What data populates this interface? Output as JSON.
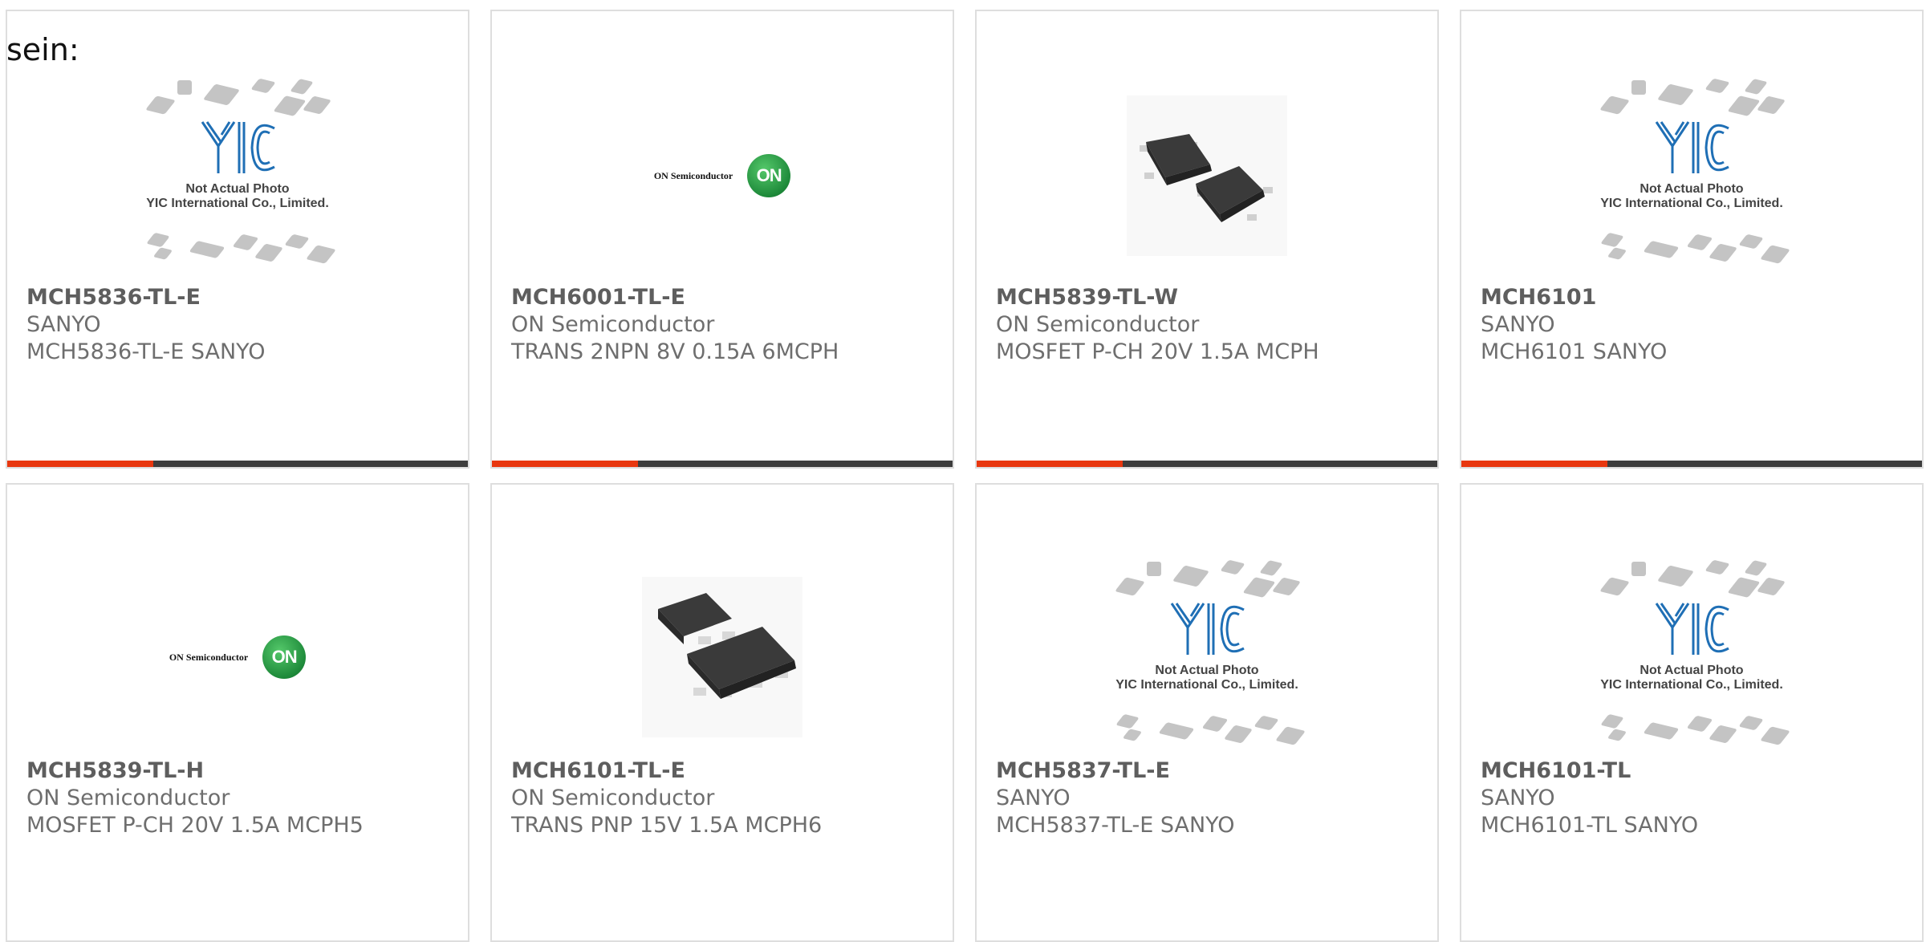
{
  "intro_text": "sein:",
  "placeholder": {
    "line1": "Not Actual Photo",
    "line2": "YIC International Co., Limited.",
    "logo_text": "YIC"
  },
  "on_logo": {
    "text": "ON Semiconductor",
    "mark": "ON"
  },
  "colors": {
    "accent": "#e8370f",
    "bar": "#3d3d3d",
    "border": "#dedede",
    "on_green": "#1e8a3a",
    "yic_blue": "#1f6fb5"
  },
  "products": [
    {
      "part": "MCH5836-TL-E",
      "manufacturer": "SANYO",
      "description": "MCH5836-TL-E SANYO",
      "image": "yic-placeholder"
    },
    {
      "part": "MCH6001-TL-E",
      "manufacturer": "ON Semiconductor",
      "description": "TRANS 2NPN 8V 0.15A 6MCPH",
      "image": "on-semiconductor-logo"
    },
    {
      "part": "MCH5839-TL-W",
      "manufacturer": "ON Semiconductor",
      "description": "MOSFET P-CH 20V 1.5A MCPH",
      "image": "package-photo"
    },
    {
      "part": "MCH6101",
      "manufacturer": "SANYO",
      "description": "MCH6101 SANYO",
      "image": "yic-placeholder"
    },
    {
      "part": "MCH5839-TL-H",
      "manufacturer": "ON Semiconductor",
      "description": "MOSFET P-CH 20V 1.5A MCPH5",
      "image": "on-semiconductor-logo"
    },
    {
      "part": "MCH6101-TL-E",
      "manufacturer": "ON Semiconductor",
      "description": "TRANS PNP 15V 1.5A MCPH6",
      "image": "package-photo"
    },
    {
      "part": "MCH5837-TL-E",
      "manufacturer": "SANYO",
      "description": "MCH5837-TL-E SANYO",
      "image": "yic-placeholder"
    },
    {
      "part": "MCH6101-TL",
      "manufacturer": "SANYO",
      "description": "MCH6101-TL SANYO",
      "image": "yic-placeholder"
    }
  ]
}
